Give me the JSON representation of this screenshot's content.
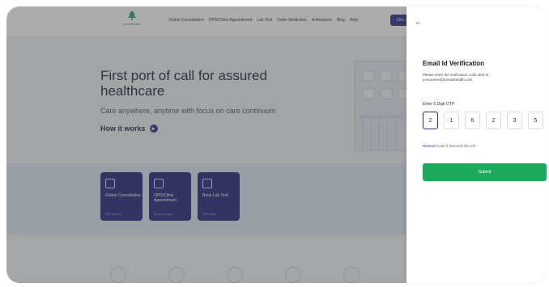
{
  "header": {
    "logo_text": "yourlifeline",
    "nav": [
      "Online Consultation",
      "OPD/Clinic Appointment",
      "Lab Test",
      "Order Medicines",
      "Ambulance",
      "Blog",
      "Help"
    ],
    "cta_label": "Onl..."
  },
  "hero": {
    "title": "First port of call for assured healthcare",
    "subtitle": "Care anywhere, anytime with focus on care continuum",
    "how_it_works": "How it works"
  },
  "services": [
    {
      "label": "Online Consultation",
      "sub": "Get started"
    },
    {
      "label": "OPD/Clinic Appointment",
      "sub": "Book an appt"
    },
    {
      "label": "Book Lab Test",
      "sub": "Find tests"
    }
  ],
  "panel": {
    "title": "Email Id Verification",
    "description": "Please enter the verification code sent to yourname@domainhealth.com",
    "otp_label": "Enter 6 Digit OTP",
    "otp": [
      "2",
      "1",
      "6",
      "2",
      "3",
      "5"
    ],
    "resend_link": "Resend",
    "resend_text": "Code 0 Seconds 00 Left",
    "submit": "Submit"
  },
  "colors": {
    "primary": "#2a2e86",
    "success": "#1eaa5c"
  }
}
